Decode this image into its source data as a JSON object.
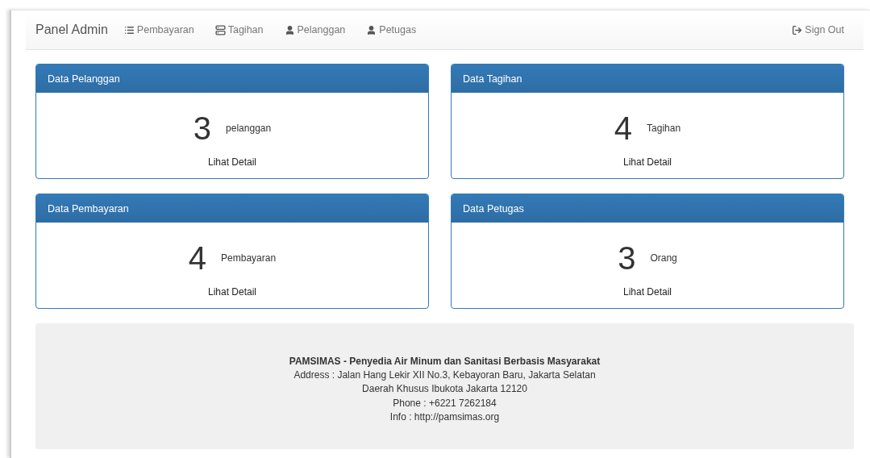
{
  "navbar": {
    "brand": "Panel Admin",
    "items": [
      {
        "label": "Pembayaran"
      },
      {
        "label": "Tagihan"
      },
      {
        "label": "Pelanggan"
      },
      {
        "label": "Petugas"
      }
    ],
    "sign_out": "Sign Out"
  },
  "panels": [
    {
      "title": "Data Pelanggan",
      "count": "3",
      "unit": "pelanggan",
      "link": "Lihat Detail"
    },
    {
      "title": "Data Tagihan",
      "count": "4",
      "unit": "Tagihan",
      "link": "Lihat Detail"
    },
    {
      "title": "Data Pembayaran",
      "count": "4",
      "unit": "Pembayaran",
      "link": "Lihat Detail"
    },
    {
      "title": "Data Petugas",
      "count": "3",
      "unit": "Orang",
      "link": "Lihat Detail"
    }
  ],
  "footer": {
    "title": "PAMSIMAS - Penyedia Air Minum dan Sanitasi Berbasis Masyarakat",
    "lines": [
      "Address : Jalan Hang Lekir XII No.3, Kebayoran Baru, Jakarta Selatan",
      "Daerah Khusus Ibukota Jakarta 12120",
      "Phone : +6221 7262184",
      "Info : http://pamsimas.org"
    ]
  }
}
